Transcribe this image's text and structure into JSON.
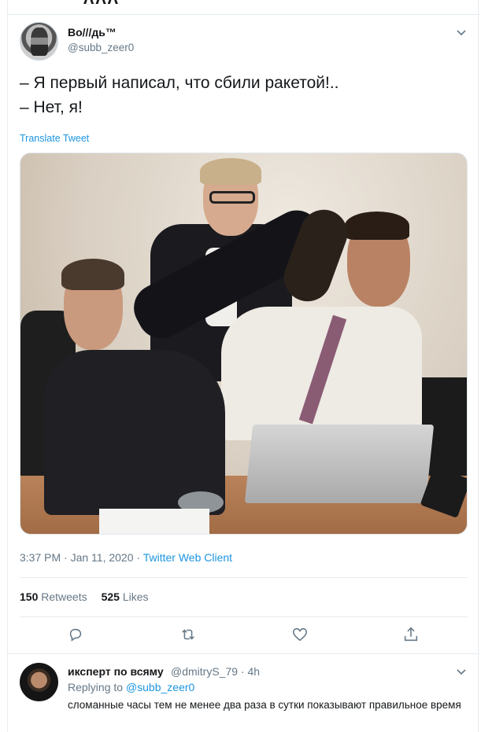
{
  "previous_tweet_sliver": "ΛΛΛ",
  "tweet": {
    "author_name": "Во///дь™",
    "author_handle": "@subb_zeer0",
    "text": "– Я первый написал, что сбили ракетой!..\n– Нет, я!",
    "translate_label": "Translate Tweet",
    "timestamp": "3:37 PM · Jan 11, 2020",
    "separator": " · ",
    "client": "Twitter Web Client",
    "retweets_count": "150",
    "retweets_label": "Retweets",
    "likes_count": "525",
    "likes_label": "Likes",
    "icons": [
      "chevron-down-icon",
      "reply-icon",
      "retweet-icon",
      "like-icon",
      "share-icon"
    ]
  },
  "reply": {
    "author_name": "иксперт по всяму",
    "author_handle": "@dmitryS_79 · 4h",
    "replying_prefix": "Replying to",
    "replying_mention": "@subb_zeer0",
    "text": "сломанные часы тем не менее два раза в сутки показывают правильное время"
  },
  "colors": {
    "accent": "#1b95e0",
    "secondary_text": "#657786",
    "border": "#e6ecf0",
    "text": "#14171a"
  }
}
